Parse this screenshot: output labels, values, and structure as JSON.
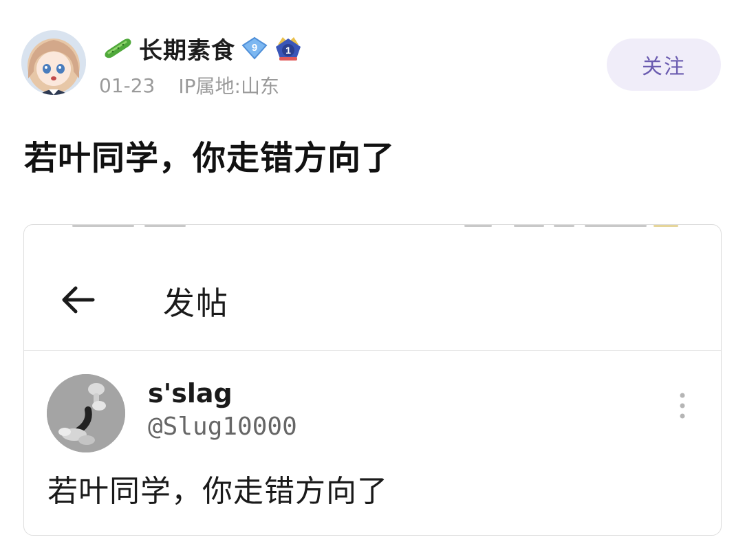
{
  "post": {
    "author": {
      "name": "长期素食",
      "name_icon": "cucumber-icon",
      "badges": [
        {
          "icon": "diamond-level-badge-icon",
          "text": "9",
          "color": "#6aa7ee"
        },
        {
          "icon": "rank-crown-badge-icon",
          "text": "1",
          "color": "#3a56b8"
        }
      ]
    },
    "date": "01-23",
    "ip_location": "IP属地:山东",
    "follow_label": "关注",
    "title": "若叶同学，你走错方向了"
  },
  "embed": {
    "page_title": "发帖",
    "back_icon": "back-arrow-icon",
    "tweet": {
      "name": "s'slag",
      "handle": "@Slug10000",
      "text": "若叶同学，你走错方向了",
      "more_icon": "more-vertical-icon"
    }
  },
  "colors": {
    "accent": "#6a5bb0",
    "follow_bg": "#f0edf9",
    "meta_text": "#9a9a9a"
  }
}
